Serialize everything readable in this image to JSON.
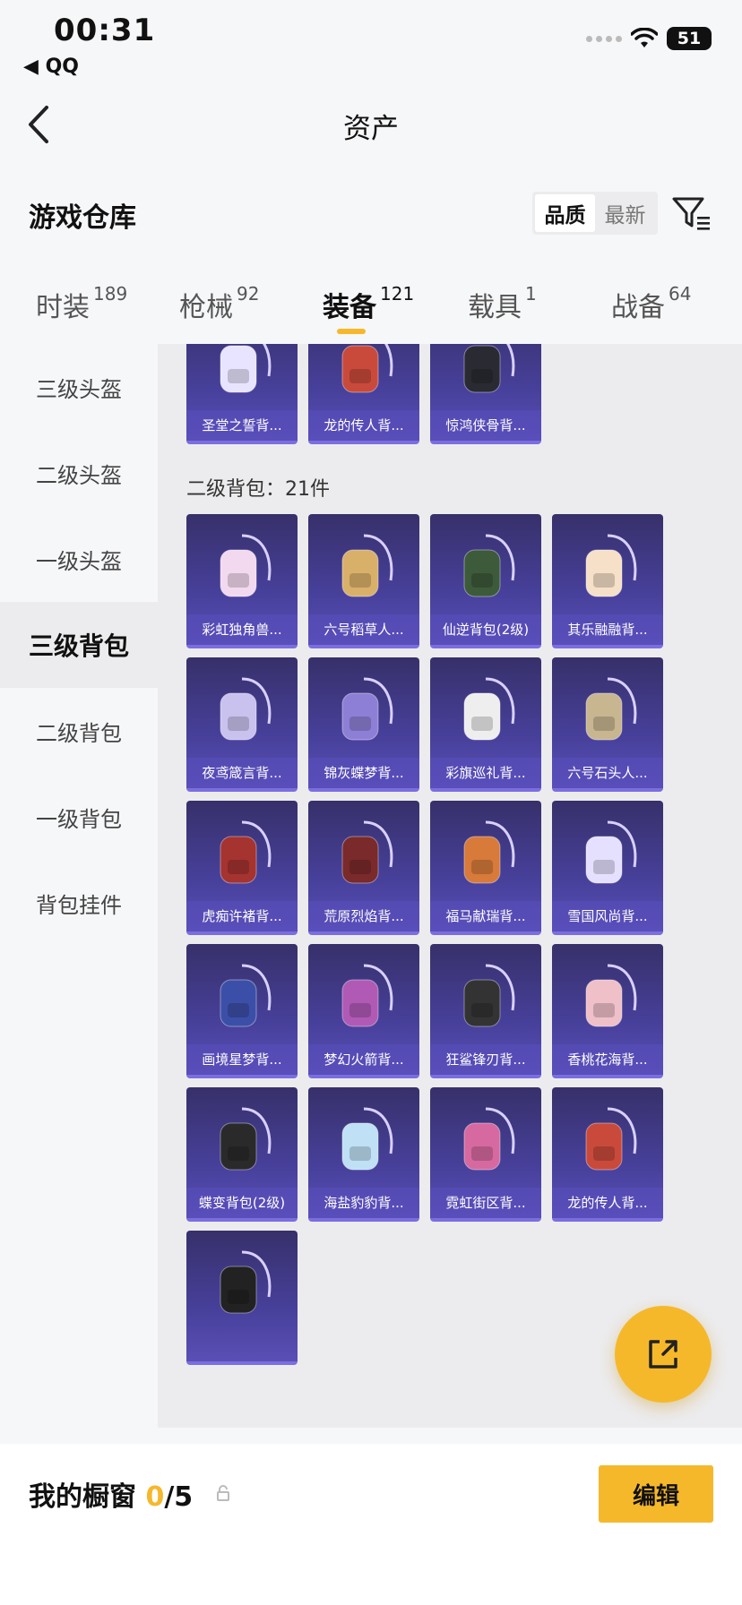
{
  "status_bar": {
    "time": "00:31",
    "back_app": "◀ QQ",
    "battery": "51"
  },
  "navbar": {
    "title": "资产"
  },
  "warehouse": {
    "title": "游戏仓库",
    "sort_options": [
      "品质",
      "最新"
    ],
    "active_sort": "品质"
  },
  "tabs": [
    {
      "label": "时装",
      "count": "189"
    },
    {
      "label": "枪械",
      "count": "92"
    },
    {
      "label": "装备",
      "count": "121"
    },
    {
      "label": "载具",
      "count": "1"
    },
    {
      "label": "战备",
      "count": "64"
    }
  ],
  "active_tab": "装备",
  "sidebar": {
    "items": [
      "三级头盔",
      "二级头盔",
      "一级头盔",
      "三级背包",
      "二级背包",
      "一级背包",
      "背包挂件"
    ],
    "active": "三级背包"
  },
  "sections": [
    {
      "label": "",
      "items": [
        "圣堂之誓背...",
        "龙的传人背...",
        "惊鸿侠骨背..."
      ]
    },
    {
      "label": "二级背包：21件",
      "items": [
        "彩虹独角兽...",
        "六号稻草人...",
        "仙逆背包(2级)",
        "其乐融融背...",
        "夜鸢箴言背...",
        "锦灰蝶梦背...",
        "彩旗巡礼背...",
        "六号石头人...",
        "虎痴许褚背...",
        "荒原烈焰背...",
        "福马献瑞背...",
        "雪国风尚背...",
        "画境星梦背...",
        "梦幻火箭背...",
        "狂鲨锋刃背...",
        "香桃花海背...",
        "蝶变背包(2级)",
        "海盐豹豹背...",
        "霓虹街区背...",
        "龙的传人背...",
        ""
      ]
    }
  ],
  "bottom_bar": {
    "showcase_label": "我的橱窗",
    "showcase_current": "0",
    "showcase_total": "/5",
    "edit_label": "编辑"
  },
  "colors": {
    "accent": "#f6b82b",
    "card_bg": "#47409a",
    "card_border": "#7a6ee0"
  },
  "icons": [
    "back-arrow-icon",
    "filter-icon",
    "lock-icon",
    "share-icon",
    "wifi-icon"
  ]
}
